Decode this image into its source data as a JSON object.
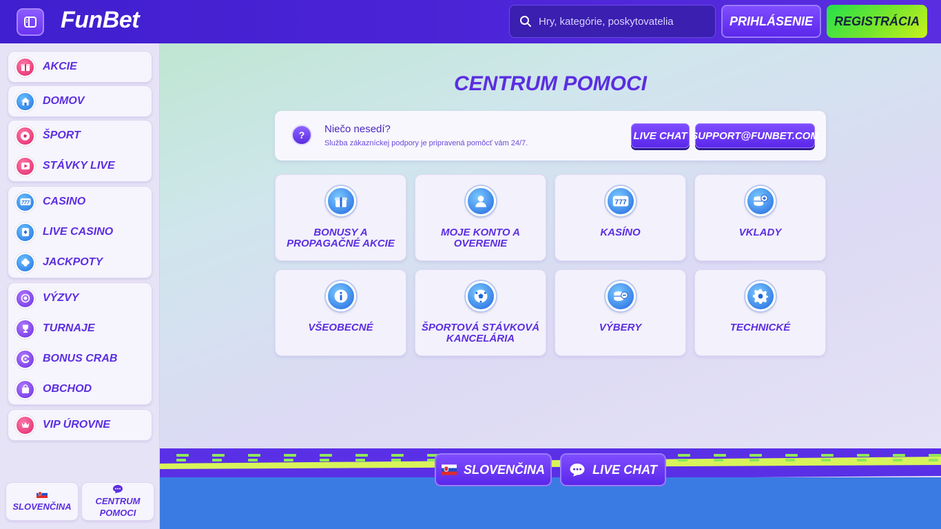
{
  "header": {
    "logo_text": "FunBet",
    "search_placeholder": "Hry, kategórie, poskytovatelia",
    "login_label": "PRIHLÁSENIE",
    "register_label": "REGISTRÁCIA"
  },
  "sidebar": {
    "groups": [
      {
        "items": [
          {
            "label": "AKCIE",
            "icon": "gift-icon"
          }
        ]
      },
      {
        "items": [
          {
            "label": "DOMOV",
            "icon": "home-icon"
          }
        ]
      },
      {
        "items": [
          {
            "label": "ŠPORT",
            "icon": "soccer-ball-icon"
          },
          {
            "label": "STÁVKY LIVE",
            "icon": "play-icon"
          }
        ]
      },
      {
        "items": [
          {
            "label": "CASINO",
            "icon": "slot-777-icon"
          },
          {
            "label": "LIVE CASINO",
            "icon": "card-icon"
          },
          {
            "label": "JACKPOTY",
            "icon": "clover-icon"
          }
        ]
      },
      {
        "items": [
          {
            "label": "VÝZVY",
            "icon": "badge-icon"
          },
          {
            "label": "TURNAJE",
            "icon": "trophy-icon"
          },
          {
            "label": "BONUS CRAB",
            "icon": "crab-icon"
          },
          {
            "label": "OBCHOD",
            "icon": "shopping-bag-icon"
          }
        ]
      },
      {
        "items": [
          {
            "label": "VIP ÚROVNE",
            "icon": "crown-icon"
          }
        ]
      }
    ],
    "language_label": "SLOVENČINA",
    "help_label_line1": "CENTRUM",
    "help_label_line2": "POMOCI"
  },
  "main": {
    "title": "CENTRUM POMOCI",
    "help_card": {
      "title": "Niečo nesedí?",
      "subtitle": "Služba zákazníckej podpory je pripravená pomôcť vám 24/7.",
      "live_chat_label": "LIVE CHAT",
      "email_label": "SUPPORT@FUNBET.COM"
    },
    "categories": [
      {
        "label": "BONUSY A PROPAGAČNÉ AKCIE",
        "icon": "gift-icon"
      },
      {
        "label": "MOJE KONTO A OVERENIE",
        "icon": "user-icon"
      },
      {
        "label": "KASÍNO",
        "icon": "slot-777-icon"
      },
      {
        "label": "VKLADY",
        "icon": "coins-plus-icon"
      },
      {
        "label": "VŠEOBECNÉ",
        "icon": "info-icon"
      },
      {
        "label": "ŠPORTOVÁ STÁVKOVÁ KANCELÁRIA",
        "icon": "soccer-ball-icon"
      },
      {
        "label": "VÝBERY",
        "icon": "coins-minus-icon"
      },
      {
        "label": "TECHNICKÉ",
        "icon": "gear-icon"
      }
    ]
  },
  "footer": {
    "language_label": "SLOVENČINA",
    "live_chat_label": "LIVE CHAT"
  },
  "colors": {
    "brand_purple": "#5b2ee0",
    "header_bg": "#4b23d6",
    "register_green": "#7ae62b",
    "footer_blue": "#3a7be3"
  }
}
